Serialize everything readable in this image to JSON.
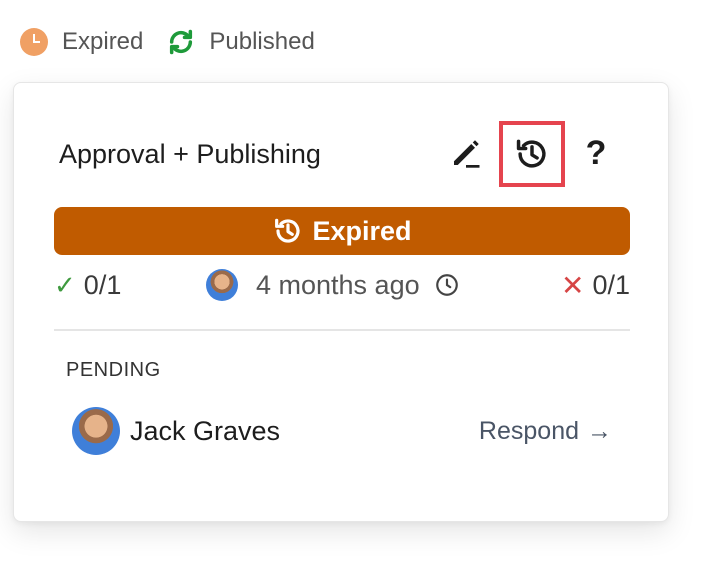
{
  "status_bar": {
    "expired_label": "Expired",
    "published_label": "Published",
    "colors": {
      "expired": "#f0a064",
      "published": "#1e9a3a"
    }
  },
  "card": {
    "title": "Approval + Publishing",
    "toolbar": {
      "edit_icon": "edit-pen-icon",
      "history_icon": "history-icon",
      "help_label": "?"
    },
    "banner": {
      "label": "Expired",
      "icon": "history-icon",
      "color": "#c05b00"
    },
    "stats": {
      "approved": "0/1",
      "time_ago": "4 months ago",
      "rejected": "0/1"
    },
    "pending": {
      "section_label": "PENDING",
      "reviewers": [
        {
          "name": "Jack Graves",
          "action_label": "Respond",
          "action_arrow": "→"
        }
      ]
    }
  }
}
